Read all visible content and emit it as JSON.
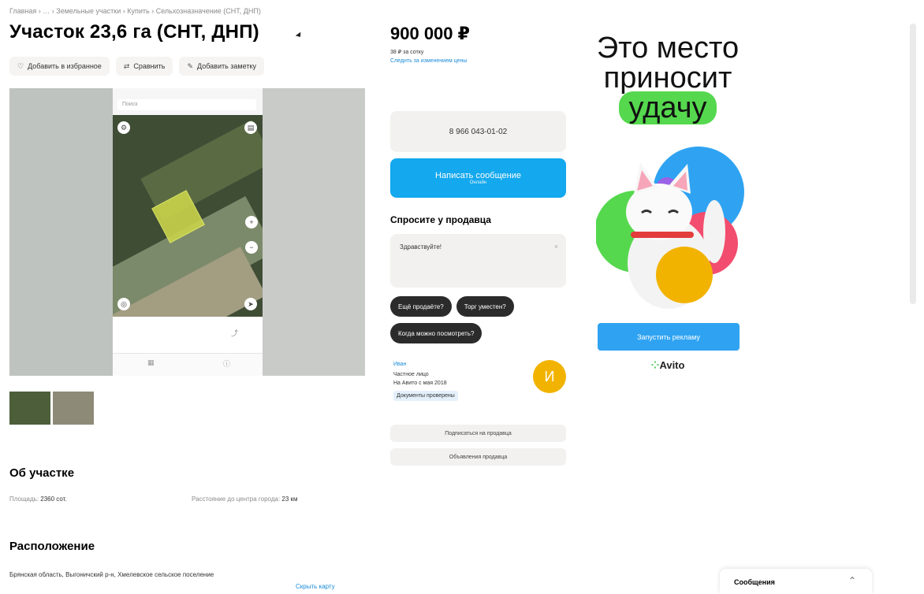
{
  "breadcrumbs": "Главная › … › Земельные участки › Купить › Сельхозназначение (СНТ, ДНП)",
  "title": "Участок 23,6 га (СНТ, ДНП)",
  "actions": {
    "favorite": "Добавить в избранное",
    "compare": "Сравнить",
    "note": "Добавить заметку"
  },
  "gallery": {
    "search_placeholder": "Поиск",
    "info_line1": "",
    "info_line2": "",
    "tab1": "",
    "tab2": ""
  },
  "price": {
    "value": "900 000 ₽",
    "per_unit": "38 ₽ за сотку",
    "link": "Следить за изменением цены"
  },
  "contact": {
    "phone": "8 966 043-01-02",
    "write_message": "Написать сообщение",
    "write_sub": "Онлайн"
  },
  "ask": {
    "title": "Спросите у продавца",
    "placeholder": "Здравствуйте!",
    "chips": [
      "Ещё продаёте?",
      "Торг уместен?",
      "Когда можно посмотреть?"
    ]
  },
  "seller": {
    "name": "Иван",
    "type": "Частное лицо",
    "since": "На Авито с мая 2018",
    "badge": "Документы проверены",
    "avatar_letter": "И",
    "subscribe": "Подписаться на продавца",
    "other_ads": "Объявления продавца"
  },
  "about": {
    "title": "Об участке",
    "area_label": "Площадь:",
    "area_value": "2360 сот.",
    "distance_label": "Расстояние до центра города:",
    "distance_value": "23 км"
  },
  "location": {
    "title": "Расположение",
    "address": "Брянская область, Выгоничский р-н, Хмелевское сельское поселение",
    "map_link": "Скрыть карту"
  },
  "ad": {
    "line1": "Это место",
    "line2": "приносит",
    "line3": "удачу",
    "cta": "Запустить рекламу",
    "brand": "Avito"
  },
  "messages_bar": {
    "title": "Сообщения"
  },
  "colors": {
    "accent_blue": "#14a8ee",
    "ad_green": "#55d84e",
    "avatar_yellow": "#f2b300"
  }
}
